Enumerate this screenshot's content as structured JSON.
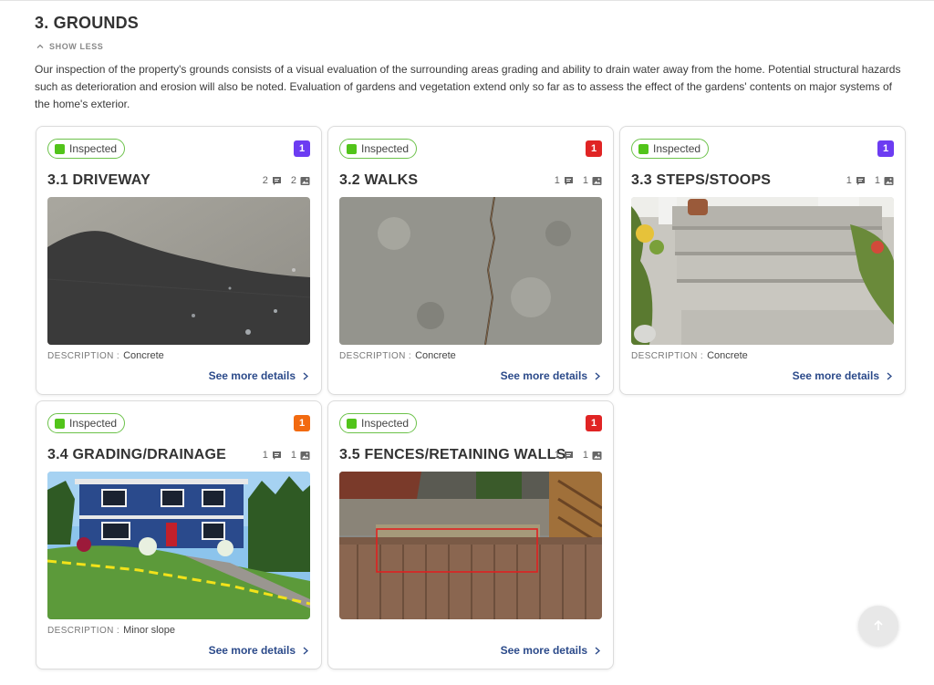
{
  "section": {
    "title": "3. GROUNDS",
    "toggle_label": "SHOW LESS",
    "intro": "Our inspection of the property's grounds consists of  a visual evaluation of the surrounding areas grading and ability to drain water away from the home. Potential structural hazards such as deterioration and erosion will also be noted. Evaluation of gardens and vegetation extend only so far as to assess the effect of the gardens' contents on major systems of the home's exterior."
  },
  "cards": [
    {
      "status": "Inspected",
      "count": "1",
      "count_color": "#6c3cf2",
      "title": "3.1 DRIVEWAY",
      "comments": "2",
      "photos": "2",
      "desc_label": "DESCRIPTION :",
      "desc_value": "Concrete",
      "link": "See more details"
    },
    {
      "status": "Inspected",
      "count": "1",
      "count_color": "#e02424",
      "title": "3.2 WALKS",
      "comments": "1",
      "photos": "1",
      "desc_label": "DESCRIPTION :",
      "desc_value": "Concrete",
      "link": "See more details"
    },
    {
      "status": "Inspected",
      "count": "1",
      "count_color": "#6c3cf2",
      "title": "3.3 STEPS/STOOPS",
      "comments": "1",
      "photos": "1",
      "desc_label": "DESCRIPTION :",
      "desc_value": "Concrete",
      "link": "See more details"
    },
    {
      "status": "Inspected",
      "count": "1",
      "count_color": "#f26a10",
      "title": "3.4 GRADING/DRAINAGE",
      "comments": "1",
      "photos": "1",
      "desc_label": "DESCRIPTION :",
      "desc_value": "Minor slope",
      "link": "See more details"
    },
    {
      "status": "Inspected",
      "count": "1",
      "count_color": "#e02424",
      "title": "3.5 FENCES/RETAINING WALLS",
      "comments": "1",
      "photos": "1",
      "desc_label": "",
      "desc_value": "",
      "link": "See more details"
    }
  ],
  "icons": {
    "toggle": "chevron-up-icon",
    "comment": "comment-icon",
    "photo": "image-icon",
    "link_arrow": "chevron-right-icon",
    "scroll_top": "arrow-up-icon"
  }
}
